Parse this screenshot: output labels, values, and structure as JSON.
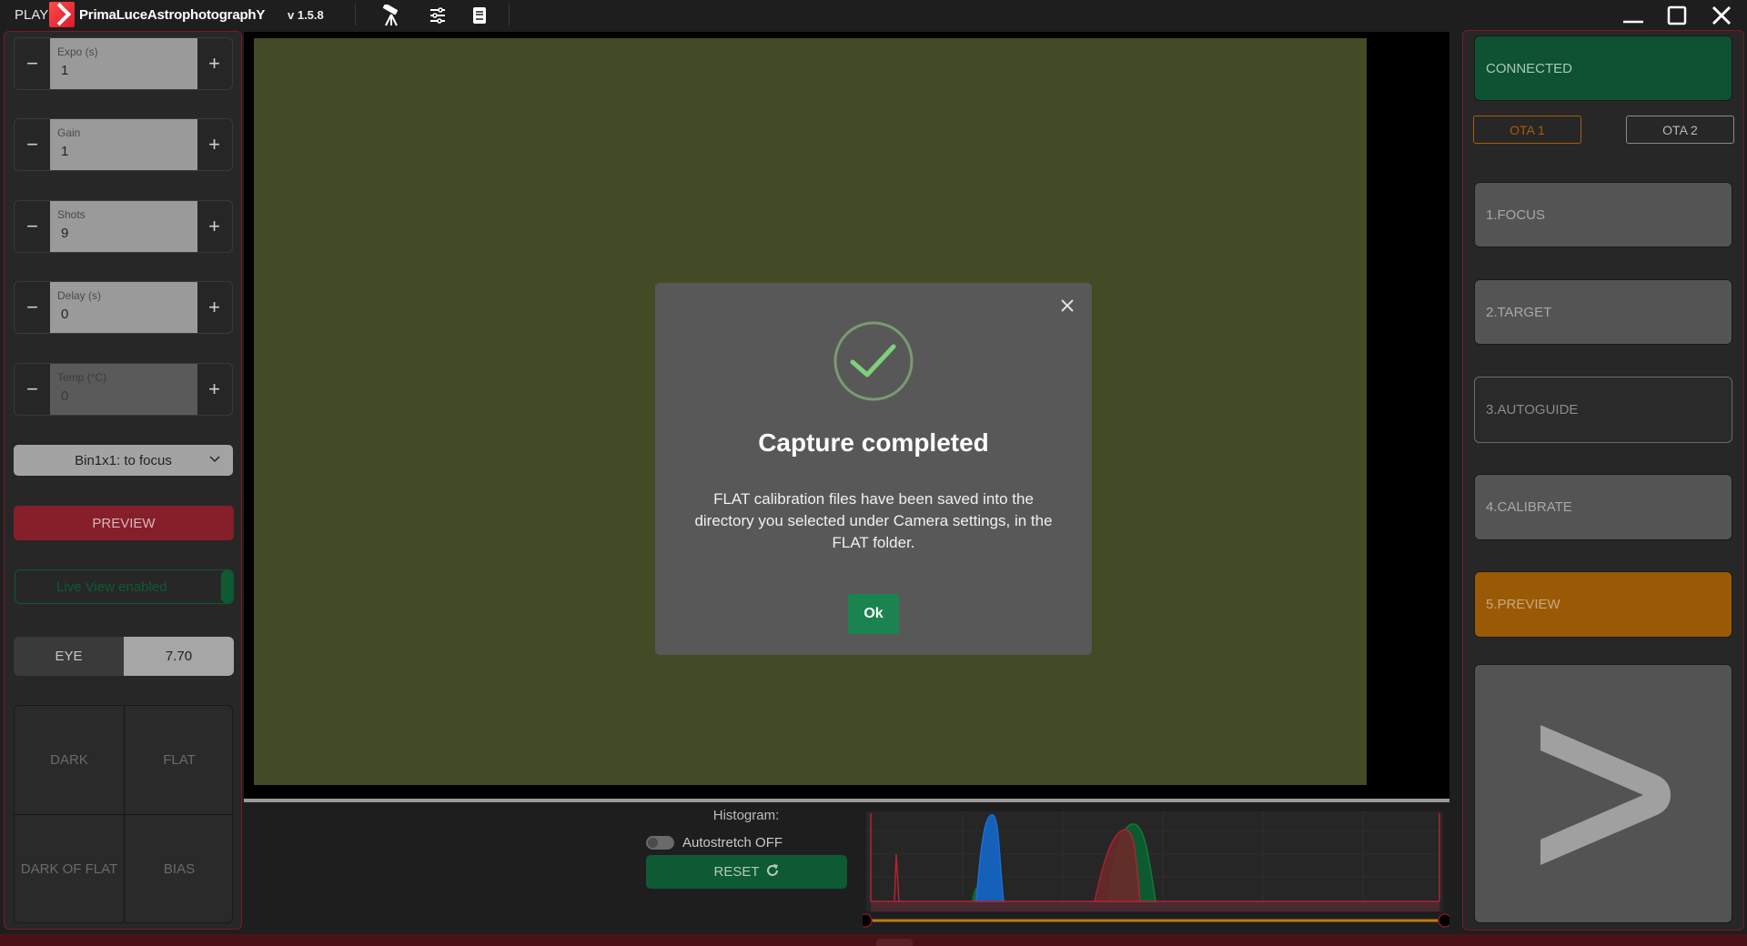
{
  "titlebar": {
    "play_label": "PLAY",
    "brand": "PrimaLuceAstrophotographY",
    "version": "v 1.5.8",
    "icons": [
      "telescope-icon",
      "sliders-icon",
      "book-icon"
    ],
    "window_controls": [
      "minimize",
      "maximize",
      "close"
    ]
  },
  "left": {
    "steppers": [
      {
        "label": "Expo (s)",
        "value": "1",
        "enabled": true
      },
      {
        "label": "Gain",
        "value": "1",
        "enabled": true
      },
      {
        "label": "Shots",
        "value": "9",
        "enabled": true
      },
      {
        "label": "Delay (s)",
        "value": "0",
        "enabled": true
      },
      {
        "label": "Temp (°C)",
        "value": "0",
        "enabled": false
      }
    ],
    "minus_symbol": "−",
    "plus_symbol": "+",
    "bin_select": "Bin1x1: to focus",
    "preview_button": "PREVIEW",
    "live_view": "Live View enabled",
    "eye_label": "EYE",
    "eye_value": "7.70",
    "calibration": [
      "DARK",
      "FLAT",
      "DARK OF FLAT",
      "BIAS"
    ]
  },
  "histogram": {
    "label": "Histogram:",
    "autostretch": "Autostretch OFF",
    "autostretch_on": false,
    "reset_button": "RESET",
    "range_low": 0,
    "range_high": 1,
    "colors": {
      "red": "#b3222f",
      "green": "#0e7a3a",
      "blue": "#1560b8",
      "slider": "#c07a10"
    }
  },
  "right": {
    "connected": "CONNECTED",
    "ota1": "OTA 1",
    "ota2": "OTA 2",
    "steps": [
      "1.FOCUS",
      "2.TARGET",
      "3.AUTOGUIDE",
      "4.CALIBRATE",
      "5.PREVIEW"
    ],
    "active_step": "5.PREVIEW",
    "next_symbol": ">"
  },
  "modal": {
    "title": "Capture completed",
    "message": "FLAT calibration files have been saved into the directory you selected under Camera settings, in the FLAT folder.",
    "ok_button": "Ok"
  },
  "colors": {
    "accent_red": "#861f29",
    "connected_green": "#0f5133",
    "active_orange": "#9a5a05",
    "image_olive": "#434a26"
  }
}
